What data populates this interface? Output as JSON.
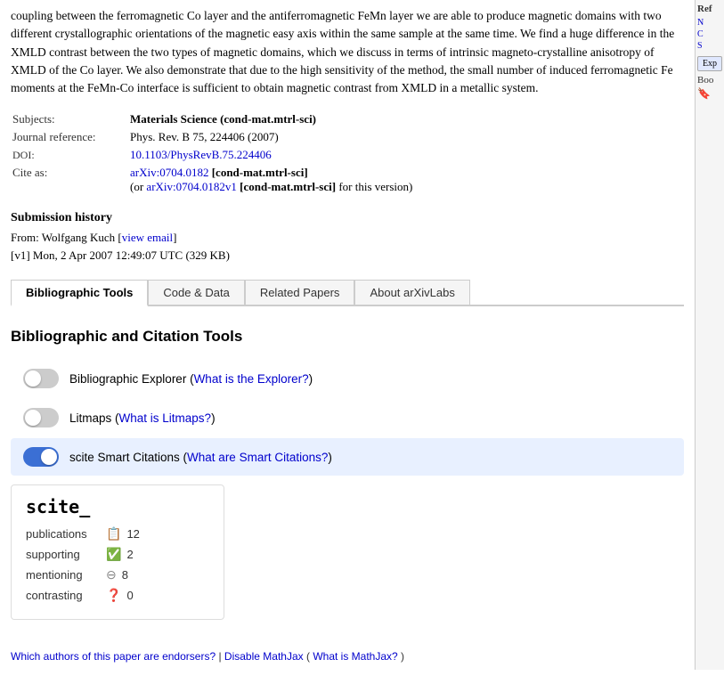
{
  "abstract": {
    "text": "coupling between the ferromagnetic Co layer and the antiferromagnetic FeMn layer we are able to produce magnetic domains with two different crystallographic orientations of the magnetic easy axis within the same sample at the same time. We find a huge difference in the XMLD contrast between the two types of magnetic domains, which we discuss in terms of intrinsic magneto-crystalline anisotropy of XMLD of the Co layer. We also demonstrate that due to the high sensitivity of the method, the small number of induced ferromagnetic Fe moments at the FeMn-Co interface is sufficient to obtain magnetic contrast from XMLD in a metallic system."
  },
  "metadata": {
    "subjects_label": "Subjects:",
    "subjects_value": "Materials Science (cond-mat.mtrl-sci)",
    "journal_label": "Journal reference:",
    "journal_value": "Phys. Rev. B 75, 224406 (2007)",
    "doi_label": "DOI:",
    "doi_value": "10.1103/PhysRevB.75.224406",
    "doi_url": "https://doi.org/10.1103/PhysRevB.75.224406",
    "cite_label": "Cite as:",
    "cite_primary": "arXiv:0704.0182",
    "cite_primary_url": "https://arxiv.org/abs/0704.0182",
    "cite_bracket": "[cond-mat.mtrl-sci]",
    "cite_or": "(or",
    "cite_v1": "arXiv:0704.0182v1",
    "cite_v1_url": "https://arxiv.org/abs/0704.0182v1",
    "cite_v1_bracket": "[cond-mat.mtrl-sci]",
    "cite_v1_suffix": "for this version)"
  },
  "submission": {
    "title": "Submission history",
    "from_label": "From: Wolfgang Kuch [",
    "view_email_label": "view email",
    "from_close": "]",
    "v1_label": "[v1]",
    "v1_date": "Mon, 2 Apr 2007 12:49:07 UTC (329 KB)"
  },
  "tabs": [
    {
      "id": "bibliographic",
      "label": "Bibliographic Tools",
      "active": true
    },
    {
      "id": "code-data",
      "label": "Code & Data",
      "active": false
    },
    {
      "id": "related-papers",
      "label": "Related Papers",
      "active": false
    },
    {
      "id": "about-arxivlabs",
      "label": "About arXivLabs",
      "active": false
    }
  ],
  "bib_section": {
    "title": "Bibliographic and Citation Tools"
  },
  "toggles": [
    {
      "id": "bibliographic-explorer",
      "label": "Bibliographic Explorer (",
      "link_text": "What is the Explorer?",
      "link_url": "#",
      "label_close": ")",
      "on": false,
      "highlighted": false
    },
    {
      "id": "litmaps",
      "label": "Litmaps (",
      "link_text": "What is Litmaps?",
      "link_url": "#",
      "label_close": ")",
      "on": false,
      "highlighted": false
    },
    {
      "id": "scite-smart",
      "label": "scite Smart Citations (",
      "link_text": "What are Smart Citations?",
      "link_url": "#",
      "label_close": ")",
      "on": true,
      "highlighted": true
    }
  ],
  "scite": {
    "logo": "scite_",
    "rows": [
      {
        "label": "publications",
        "icon": "📋",
        "count": "12",
        "icon_type": "list"
      },
      {
        "label": "supporting",
        "icon": "✅",
        "count": "2",
        "icon_type": "check-circle"
      },
      {
        "label": "mentioning",
        "icon": "⊘",
        "count": "8",
        "icon_type": "circle-dash"
      },
      {
        "label": "contrasting",
        "icon": "❓",
        "count": "0",
        "icon_type": "question"
      }
    ]
  },
  "footer": {
    "endorsers_text": "Which authors of this paper are endorsers?",
    "endorsers_url": "#",
    "separator": " | ",
    "disable_mathjax_text": "Disable MathJax",
    "disable_mathjax_url": "#",
    "mathjax_paren_open": " (",
    "what_mathjax_text": "What is MathJax?",
    "what_mathjax_url": "#",
    "mathjax_paren_close": ")"
  },
  "sidebar": {
    "ref_label": "Ref",
    "links": [
      "N",
      "C",
      "S"
    ],
    "export_label": "Exp",
    "bookmark_label": "Boo"
  },
  "colors": {
    "toggle_on": "#3b6fd4",
    "toggle_off": "#cccccc",
    "highlight_bg": "#e8f0ff",
    "tab_active_border": "#cccccc"
  }
}
